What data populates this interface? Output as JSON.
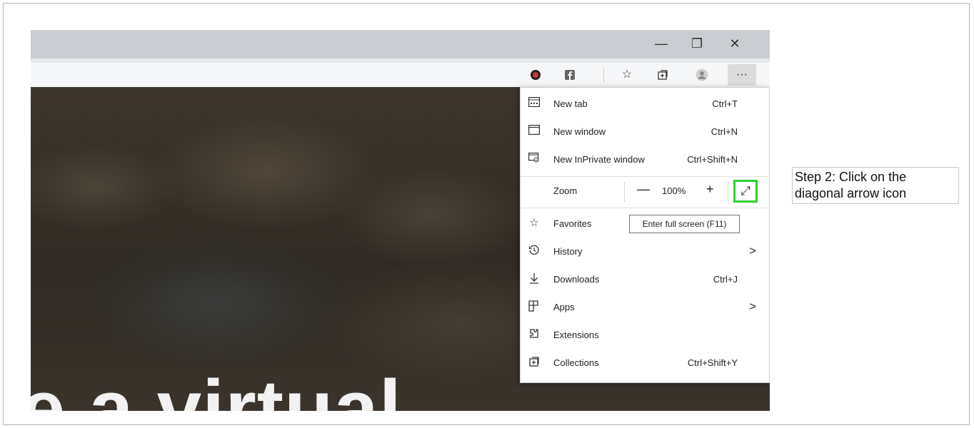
{
  "browser": {
    "window_controls": {
      "minimize": "—",
      "restore": "❐",
      "close": "✕"
    },
    "toolbar_icons": [
      "profile-badge-icon",
      "facebook-icon",
      "favorites-star-icon",
      "collections-icon",
      "account-avatar-icon",
      "more-menu-icon"
    ],
    "more_label": "···"
  },
  "menu": {
    "items": [
      {
        "label": "New tab",
        "shortcut": "Ctrl+T",
        "icon": "new-tab-icon"
      },
      {
        "label": "New window",
        "shortcut": "Ctrl+N",
        "icon": "new-window-icon"
      },
      {
        "label": "New InPrivate window",
        "shortcut": "Ctrl+Shift+N",
        "icon": "inprivate-icon"
      }
    ],
    "zoom": {
      "label": "Zoom",
      "minus": "—",
      "value": "100%",
      "plus": "+",
      "fullscreen_glyph": "⤢"
    },
    "items2": [
      {
        "label": "Favorites",
        "shortcut": "",
        "icon": "favorites-icon"
      },
      {
        "label": "History",
        "shortcut": "",
        "chevron": ">",
        "icon": "history-icon"
      },
      {
        "label": "Downloads",
        "shortcut": "Ctrl+J",
        "icon": "download-icon"
      },
      {
        "label": "Apps",
        "shortcut": "",
        "chevron": ">",
        "icon": "apps-icon"
      },
      {
        "label": "Extensions",
        "shortcut": "",
        "icon": "extensions-icon"
      },
      {
        "label": "Collections",
        "shortcut": "Ctrl+Shift+Y",
        "icon": "collections-icon"
      }
    ]
  },
  "tooltip": "Enter full screen (F11)",
  "page": {
    "hero_text": "e a virtual"
  },
  "annotation": {
    "step_text": "Step 2: Click on the diagonal arrow icon"
  },
  "colors": {
    "highlight": "#2fd02f",
    "page_bg": "#3b342b",
    "tabstrip": "#c9ccd1"
  }
}
